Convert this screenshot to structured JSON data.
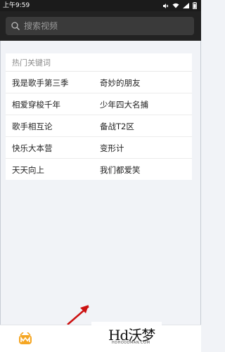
{
  "status_bar": {
    "time": "上午9:59"
  },
  "search": {
    "placeholder": "搜索视频"
  },
  "hot_keywords": {
    "title": "热门关键词",
    "rows": [
      {
        "left": "我是歌手第三季",
        "right": "奇妙的朋友"
      },
      {
        "left": "相爱穿梭千年",
        "right": "少年四大名捕"
      },
      {
        "left": "歌手相互论",
        "right": "备战T2区"
      },
      {
        "left": "快乐大本营",
        "right": "变形计"
      },
      {
        "left": "天天向上",
        "right": "我们都爱笑"
      }
    ]
  },
  "watermark": {
    "text": "Hd沃梦",
    "sub": "HDHOODMAN.COM"
  },
  "colors": {
    "header": "#222222",
    "accent": "#f5a623",
    "pointer": "#cc1111"
  }
}
